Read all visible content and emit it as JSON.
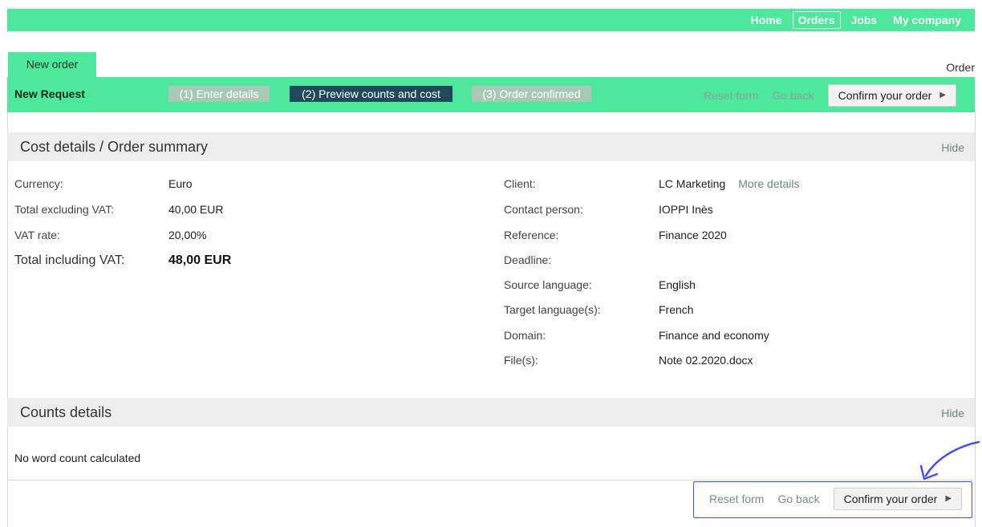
{
  "nav": {
    "items": [
      {
        "label": "Home",
        "active": false
      },
      {
        "label": "Orders",
        "active": true
      },
      {
        "label": "Jobs",
        "active": false
      },
      {
        "label": "My company",
        "active": false
      }
    ]
  },
  "tab": {
    "label": "New order"
  },
  "page_label": "Order",
  "request_bar": {
    "title": "New Request",
    "steps": [
      {
        "label": "(1) Enter details",
        "state": "inactive"
      },
      {
        "label": "(2) Preview counts and cost",
        "state": "current"
      },
      {
        "label": "(3) Order confirmed",
        "state": "inactive"
      }
    ],
    "reset_label": "Reset form",
    "back_label": "Go back",
    "confirm_label": "Confirm your order"
  },
  "cost_section": {
    "title": "Cost details / Order summary",
    "hide_label": "Hide",
    "left": [
      {
        "label": "Currency:",
        "value": "Euro"
      },
      {
        "label": "Total excluding VAT:",
        "value": "40,00 EUR"
      },
      {
        "label": "VAT rate:",
        "value": "20,00%"
      },
      {
        "label": "Total including VAT:",
        "value": "48,00 EUR"
      }
    ],
    "right": [
      {
        "label": "Client:",
        "value": "LC Marketing",
        "link": "More details"
      },
      {
        "label": "Contact person:",
        "value": "IOPPI Inès"
      },
      {
        "label": "Reference:",
        "value": "Finance 2020"
      },
      {
        "label": "Deadline:",
        "value": ""
      },
      {
        "label": "Source language:",
        "value": "English"
      },
      {
        "label": "Target language(s):",
        "value": "French"
      },
      {
        "label": "Domain:",
        "value": "Finance and economy"
      },
      {
        "label": "File(s):",
        "value": "Note 02.2020.docx"
      }
    ]
  },
  "counts_section": {
    "title": "Counts details",
    "hide_label": "Hide",
    "message": "No word count calculated"
  },
  "bottom_actions": {
    "reset_label": "Reset form",
    "back_label": "Go back",
    "confirm_label": "Confirm your order"
  },
  "colors": {
    "brand_green": "#4de89c",
    "current_step": "#1f4a5a",
    "highlight": "#4b4ff0"
  }
}
